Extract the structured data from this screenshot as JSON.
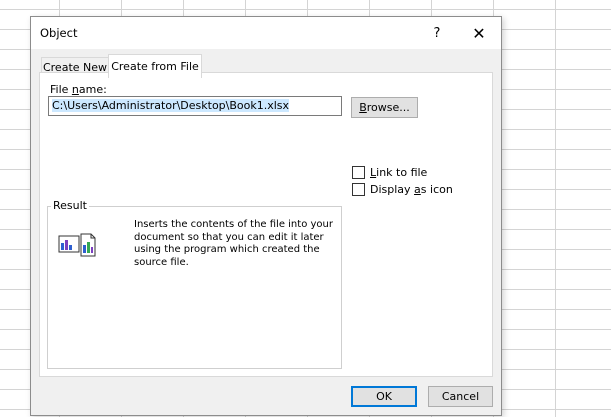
{
  "dialog": {
    "title": "Object",
    "help_label": "?",
    "close_label": "✕"
  },
  "tabs": [
    {
      "label": "Create New",
      "active": false
    },
    {
      "label": "Create from File",
      "active": true
    }
  ],
  "file": {
    "label": "File name:",
    "value": "C:\\Users\\Administrator\\Desktop\\Book1.xlsx"
  },
  "buttons": {
    "browse": "Browse...",
    "ok": "OK",
    "cancel": "Cancel"
  },
  "options": {
    "link_to_file": {
      "label": "Link to file",
      "checked": false
    },
    "display_as_icon": {
      "label": "Display as icon",
      "checked": false
    }
  },
  "result": {
    "label": "Result",
    "description": "Inserts the contents of the file into your document so that you can edit it later using the program which created the source file."
  },
  "colors": {
    "accent": "#0078d7",
    "selection": "#cce8ff",
    "dialog_bg": "#f0f0f0"
  }
}
